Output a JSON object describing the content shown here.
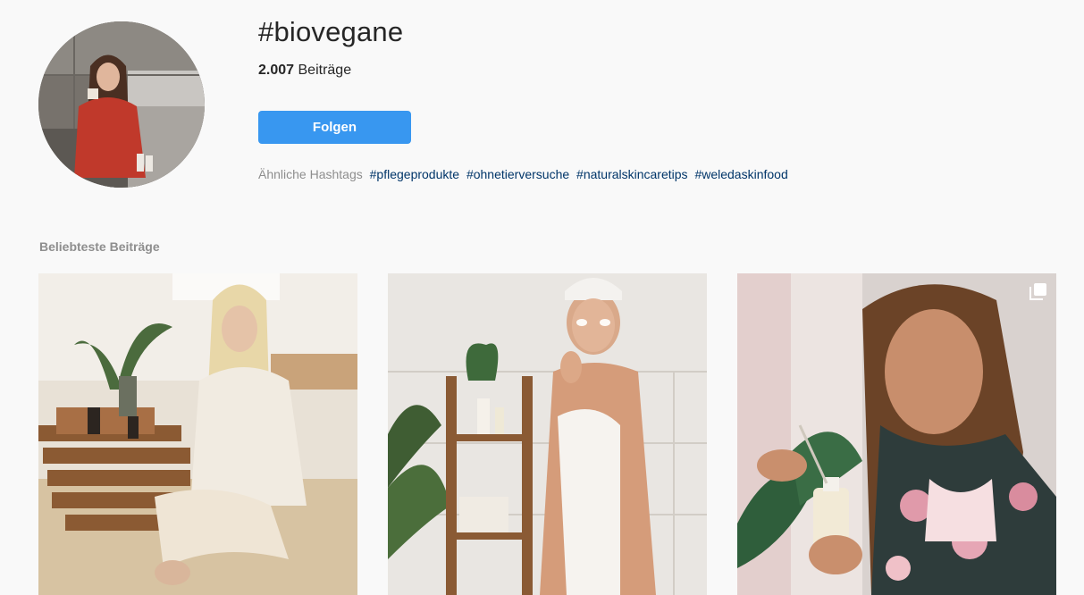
{
  "hashtag": {
    "title": "#biovegane",
    "posts_count": "2.007",
    "posts_label": "Beiträge"
  },
  "follow": {
    "label": "Folgen"
  },
  "related": {
    "label": "Ähnliche Hashtags",
    "tags": [
      "#pflegeprodukte",
      "#ohnetierversuche",
      "#naturalskincaretips",
      "#weledaskinfood"
    ]
  },
  "top_posts": {
    "title": "Beliebteste Beiträge",
    "posts": [
      {
        "icon": "photo"
      },
      {
        "icon": "photo"
      },
      {
        "icon": "multiple-photos-icon"
      }
    ]
  },
  "colors": {
    "accent": "#3897f0",
    "link": "#003569",
    "muted": "#8e8e8e",
    "background": "#f9f9f9"
  }
}
